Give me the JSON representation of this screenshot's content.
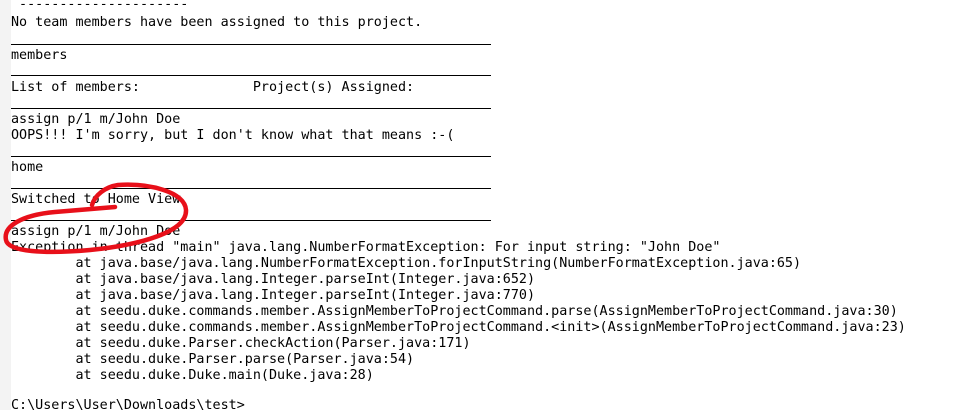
{
  "terminal": {
    "dash_line": " ---------------------",
    "no_members": "No team members have been assigned to this project.",
    "cmd_members": "members",
    "list_header": "List of members:              Project(s) Assigned:",
    "cmd_assign_1": "assign p/1 m/John Doe",
    "oops": "OOPS!!! I'm sorry, but I don't know what that means :-(",
    "cmd_home": "home",
    "switched": "Switched to Home View",
    "cmd_assign_2": "assign p/1 m/John Doe",
    "exception": "Exception in thread \"main\" java.lang.NumberFormatException: For input string: \"John Doe\"",
    "stack": [
      "        at java.base/java.lang.NumberFormatException.forInputString(NumberFormatException.java:65)",
      "        at java.base/java.lang.Integer.parseInt(Integer.java:652)",
      "        at java.base/java.lang.Integer.parseInt(Integer.java:770)",
      "        at seedu.duke.commands.member.AssignMemberToProjectCommand.parse(AssignMemberToProjectCommand.java:30)",
      "        at seedu.duke.commands.member.AssignMemberToProjectCommand.<init>(AssignMemberToProjectCommand.java:23)",
      "        at seedu.duke.Parser.checkAction(Parser.java:171)",
      "        at seedu.duke.Parser.parse(Parser.java:54)",
      "        at seedu.duke.Duke.main(Duke.java:28)"
    ],
    "prompt": "C:\\Users\\User\\Downloads\\test>"
  },
  "colors": {
    "annotation": "#e8101a",
    "text": "#000000",
    "background": "#ffffff"
  }
}
